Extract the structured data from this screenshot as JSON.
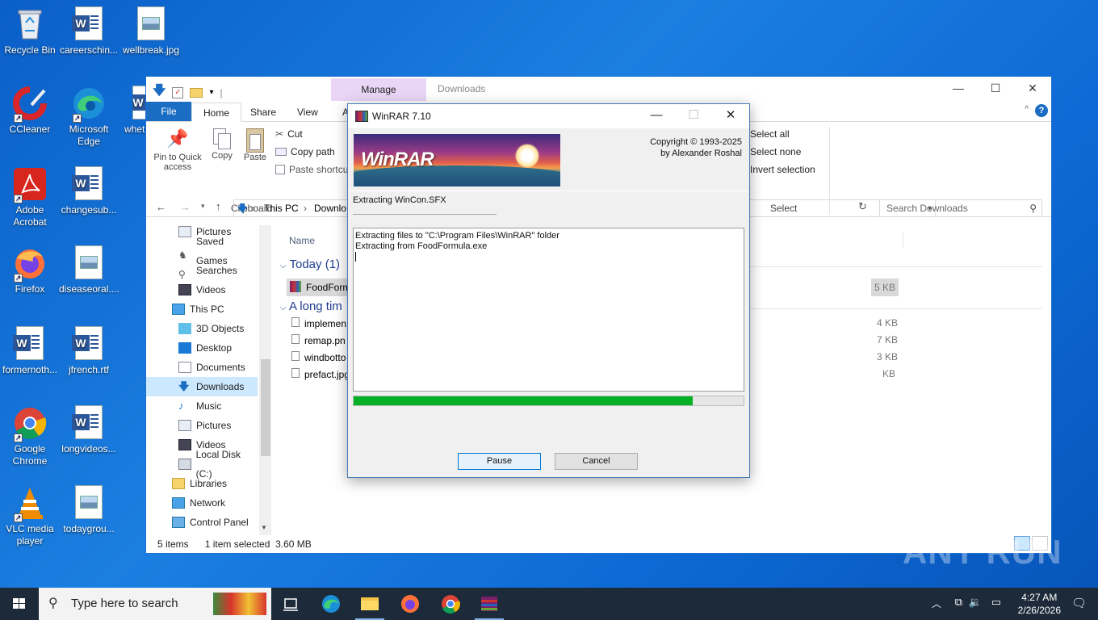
{
  "desktop": {
    "icons": [
      {
        "label": "Recycle Bin"
      },
      {
        "label": "careerschin..."
      },
      {
        "label": "wellbreak.jpg"
      },
      {
        "label": "CCleaner"
      },
      {
        "label": "Microsoft Edge"
      },
      {
        "label": "whet"
      },
      {
        "label": "Adobe Acrobat"
      },
      {
        "label": "changesub..."
      },
      {
        "label": "Firefox"
      },
      {
        "label": "diseaseoral...."
      },
      {
        "label": "formernoth..."
      },
      {
        "label": "jfrench.rtf"
      },
      {
        "label": "Google Chrome"
      },
      {
        "label": "longvideos..."
      },
      {
        "label": "VLC media player"
      },
      {
        "label": "todaygrou..."
      }
    ]
  },
  "explorer": {
    "manage_tab": "Manage",
    "title": "Downloads",
    "tabs": {
      "file": "File",
      "home": "Home",
      "share": "Share",
      "view": "View",
      "app": "A"
    },
    "ribbon": {
      "pin": "Pin to Quick access",
      "copy": "Copy",
      "paste": "Paste",
      "cut": "Cut",
      "copy_path": "Copy path",
      "paste_shortcut": "Paste shortcut",
      "clipboard_label": "Clipboard",
      "select_all": "Select all",
      "select_none": "Select none",
      "invert_selection": "Invert selection",
      "select_label": "Select"
    },
    "address": {
      "this_pc": "This PC",
      "downloads": "Downlo"
    },
    "search_placeholder": "Search Downloads",
    "nav": [
      {
        "label": "Pictures"
      },
      {
        "label": "Saved Games"
      },
      {
        "label": "Searches"
      },
      {
        "label": "Videos"
      },
      {
        "label": "This PC"
      },
      {
        "label": "3D Objects"
      },
      {
        "label": "Desktop"
      },
      {
        "label": "Documents"
      },
      {
        "label": "Downloads"
      },
      {
        "label": "Music"
      },
      {
        "label": "Pictures"
      },
      {
        "label": "Videos"
      },
      {
        "label": "Local Disk (C:)"
      },
      {
        "label": "Libraries"
      },
      {
        "label": "Network"
      },
      {
        "label": "Control Panel"
      }
    ],
    "column_name": "Name",
    "group_today": "Today (1)",
    "group_long": "A long tim",
    "files": [
      {
        "name": "FoodForm",
        "size": "5 KB"
      },
      {
        "name": "implemen",
        "size": "4 KB"
      },
      {
        "name": "remap.pn",
        "size": "7 KB"
      },
      {
        "name": "windbotto",
        "size": "3 KB"
      },
      {
        "name": "prefact.jpg",
        "size": "KB"
      }
    ],
    "status_items": "5 items",
    "status_selected": "1 item selected  3.60 MB"
  },
  "winrar": {
    "title": "WinRAR 7.10",
    "logo": "WinRAR",
    "copyright_line1": "Copyright © 1993-2025",
    "copyright_line2": "by Alexander Roshal",
    "status": "Extracting WinCon.SFX",
    "log_line1": "Extracting files to \"C:\\Program Files\\WinRAR\" folder",
    "log_line2": "Extracting from FoodFormula.exe",
    "progress": 0.87,
    "pause_label": "Pause",
    "cancel_label": "Cancel"
  },
  "taskbar": {
    "search_placeholder": "Type here to search",
    "time": "4:27 AM",
    "date": "2/26/2026"
  },
  "watermark": "ANY RUN",
  "colors": {
    "progress": "#06b025",
    "file_tab": "#1a6dc2",
    "manage": "#e9d6f6"
  }
}
